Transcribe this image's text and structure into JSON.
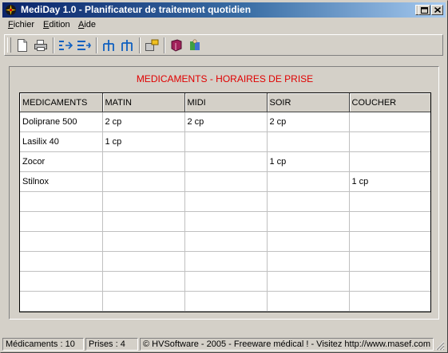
{
  "window": {
    "title": "MediDay 1.0 - Planificateur de traitement quotidien"
  },
  "menu": [
    {
      "first": "F",
      "rest": "ichier"
    },
    {
      "first": "E",
      "rest": "dition"
    },
    {
      "first": "A",
      "rest": "ide"
    }
  ],
  "toolbar": {
    "icons": [
      "new-document-icon",
      "print-icon",
      "indent-left-icon",
      "indent-right-icon",
      "schema-down-icon",
      "schema-up-icon",
      "export-icon",
      "book-icon",
      "doctor-icon"
    ]
  },
  "main": {
    "heading": "MEDICAMENTS - HORAIRES DE PRISE"
  },
  "table": {
    "columns": [
      "MEDICAMENTS",
      "MATIN",
      "MIDI",
      "SOIR",
      "COUCHER"
    ],
    "rows": [
      [
        "Doliprane 500",
        "2 cp",
        "2 cp",
        "2 cp",
        ""
      ],
      [
        "Lasilix 40",
        "1 cp",
        "",
        "",
        ""
      ],
      [
        "Zocor",
        "",
        "",
        "1 cp",
        ""
      ],
      [
        "Stilnox",
        "",
        "",
        "",
        "1 cp"
      ],
      [
        "",
        "",
        "",
        "",
        ""
      ],
      [
        "",
        "",
        "",
        "",
        ""
      ],
      [
        "",
        "",
        "",
        "",
        ""
      ],
      [
        "",
        "",
        "",
        "",
        ""
      ],
      [
        "",
        "",
        "",
        "",
        ""
      ],
      [
        "",
        "",
        "",
        "",
        ""
      ]
    ]
  },
  "status": {
    "medicaments": "Médicaments : 10",
    "prises": "Prises : 4",
    "copyright": "© HVSoftware - 2005 - Freeware médical ! - Visitez http://www.masef.com"
  },
  "colors": {
    "heading": "#e00000",
    "titlebar_start": "#0a246a",
    "titlebar_end": "#a6caf0",
    "face": "#d4d0c8"
  }
}
